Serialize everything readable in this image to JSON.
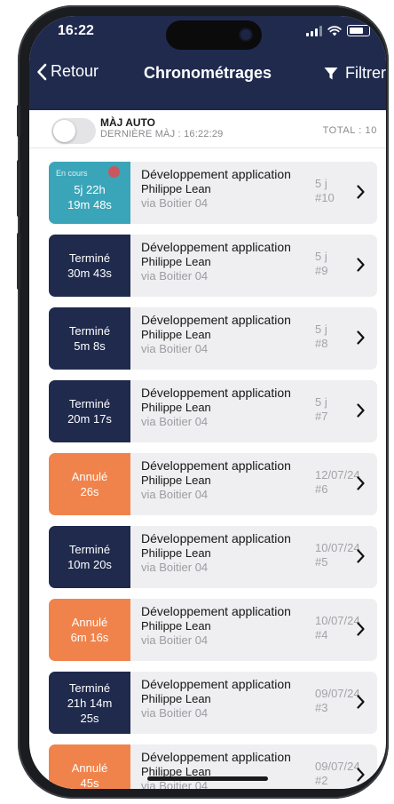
{
  "status_bar": {
    "time": "16:22"
  },
  "nav": {
    "back_label": "Retour",
    "title": "Chronométrages",
    "filter_label": "Filtrer"
  },
  "auto_update": {
    "label": "MÀJ AUTO",
    "last_update": "DERNIÈRE MÀJ : 16:22:29",
    "total": "TOTAL : 10",
    "enabled": false
  },
  "colors": {
    "header": "#1f2a4d",
    "in_progress": "#3aa5b8",
    "done": "#1f2a4d",
    "cancelled": "#f0834b"
  },
  "entries": [
    {
      "status": "En cours",
      "duration_line1": "5j 22h",
      "duration_line2": "19m 48s",
      "kind": "in_progress",
      "title": "Développement application",
      "person": "Philippe Lean",
      "via": "via Boitier 04",
      "date": "5 j",
      "number": "#10"
    },
    {
      "status": "Terminé",
      "duration_line1": "30m 43s",
      "duration_line2": "",
      "kind": "done",
      "title": "Développement application",
      "person": "Philippe Lean",
      "via": "via Boitier 04",
      "date": "5 j",
      "number": "#9"
    },
    {
      "status": "Terminé",
      "duration_line1": "5m 8s",
      "duration_line2": "",
      "kind": "done",
      "title": "Développement application",
      "person": "Philippe Lean",
      "via": "via Boitier 04",
      "date": "5 j",
      "number": "#8"
    },
    {
      "status": "Terminé",
      "duration_line1": "20m 17s",
      "duration_line2": "",
      "kind": "done",
      "title": "Développement application",
      "person": "Philippe Lean",
      "via": "via Boitier 04",
      "date": "5 j",
      "number": "#7"
    },
    {
      "status": "Annulé",
      "duration_line1": "26s",
      "duration_line2": "",
      "kind": "cancelled",
      "title": "Développement application",
      "person": "Philippe Lean",
      "via": "via Boitier 04",
      "date": "12/07/24",
      "number": "#6"
    },
    {
      "status": "Terminé",
      "duration_line1": "10m 20s",
      "duration_line2": "",
      "kind": "done",
      "title": "Développement application",
      "person": "Philippe Lean",
      "via": "via Boitier 04",
      "date": "10/07/24",
      "number": "#5"
    },
    {
      "status": "Annulé",
      "duration_line1": "6m 16s",
      "duration_line2": "",
      "kind": "cancelled",
      "title": "Développement application",
      "person": "Philippe Lean",
      "via": "via Boitier 04",
      "date": "10/07/24",
      "number": "#4"
    },
    {
      "status": "Terminé",
      "duration_line1": "21h 14m",
      "duration_line2": "25s",
      "kind": "done",
      "title": "Développement application",
      "person": "Philippe Lean",
      "via": "via Boitier 04",
      "date": "09/07/24",
      "number": "#3"
    },
    {
      "status": "Annulé",
      "duration_line1": "45s",
      "duration_line2": "",
      "kind": "cancelled",
      "title": "Développement application",
      "person": "Philippe Lean",
      "via": "via Boitier 04",
      "date": "09/07/24",
      "number": "#2"
    }
  ]
}
